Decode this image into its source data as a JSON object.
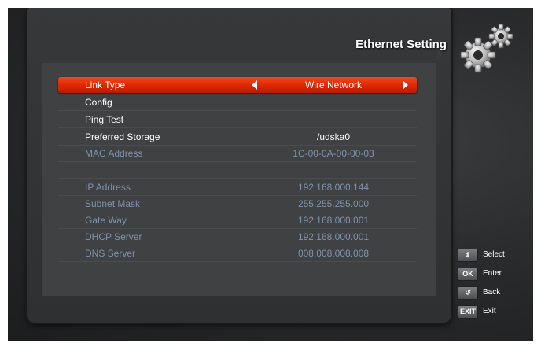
{
  "header": {
    "title": "Ethernet Setting",
    "icon": "gears-icon"
  },
  "menu": {
    "link_type": {
      "label": "Link Type",
      "value": "Wire Network"
    },
    "config": {
      "label": "Config"
    },
    "ping_test": {
      "label": "Ping Test"
    },
    "preferred_storage": {
      "label": "Preferred Storage",
      "value": "/udska0"
    },
    "mac_address": {
      "label": "MAC Address",
      "value": "1C-00-0A-00-00-03"
    },
    "ip_address": {
      "label": "IP Address",
      "value": "192.168.000.144"
    },
    "subnet_mask": {
      "label": "Subnet Mask",
      "value": "255.255.255.000"
    },
    "gateway": {
      "label": "Gate Way",
      "value": "192.168.000.001"
    },
    "dhcp_server": {
      "label": "DHCP Server",
      "value": "192.168.000.001"
    },
    "dns_server": {
      "label": "DNS Server",
      "value": "008.008.008.008"
    }
  },
  "legend": {
    "select": {
      "key": "⇕",
      "label": "Select"
    },
    "enter": {
      "key": "OK",
      "label": "Enter"
    },
    "back": {
      "key": "↺",
      "label": "Back"
    },
    "exit": {
      "key": "EXIT",
      "label": "Exit"
    }
  },
  "colors": {
    "highlight": "#e02800",
    "text_active": "#ffffff",
    "text_disabled": "#7e92ae",
    "panel": "#404142"
  }
}
